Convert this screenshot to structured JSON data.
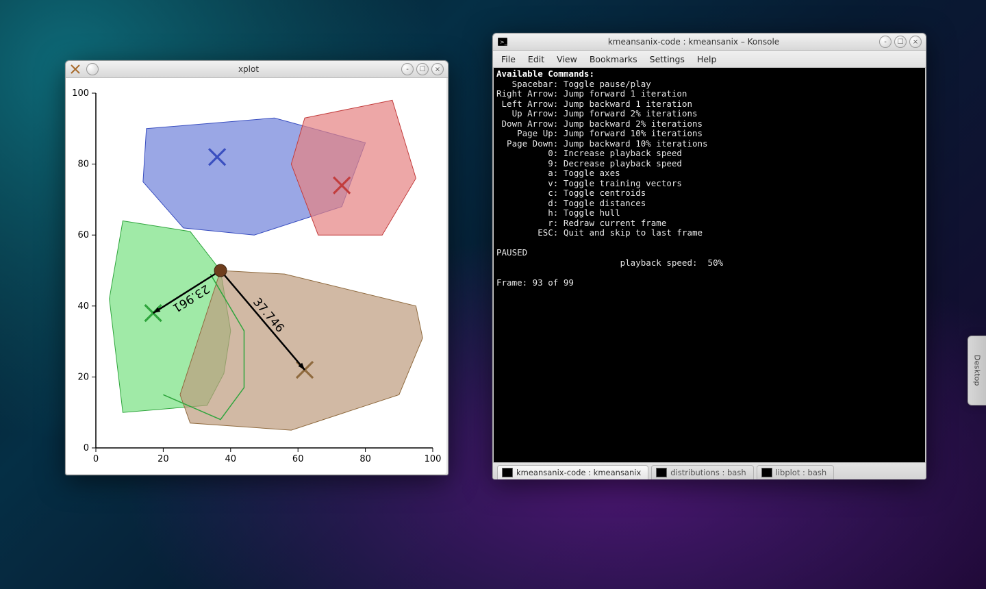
{
  "xplot": {
    "title": "xplot",
    "axis": {
      "xmin": 0,
      "xmax": 100,
      "ymin": 0,
      "ymax": 100,
      "xticks": [
        0,
        20,
        40,
        60,
        80,
        100
      ],
      "yticks": [
        0,
        20,
        40,
        60,
        80,
        100
      ]
    }
  },
  "konsole": {
    "title": "kmeansanix-code : kmeansanix – Konsole",
    "menu": {
      "file": "File",
      "edit": "Edit",
      "view": "View",
      "bookmarks": "Bookmarks",
      "settings": "Settings",
      "help": "Help"
    },
    "header": "Available Commands:",
    "commands": [
      {
        "k": "Spacebar",
        "d": "Toggle pause/play"
      },
      {
        "k": "Right Arrow",
        "d": "Jump forward 1 iteration"
      },
      {
        "k": "Left Arrow",
        "d": "Jump backward 1 iteration"
      },
      {
        "k": "Up Arrow",
        "d": "Jump forward 2% iterations"
      },
      {
        "k": "Down Arrow",
        "d": "Jump backward 2% iterations"
      },
      {
        "k": "Page Up",
        "d": "Jump forward 10% iterations"
      },
      {
        "k": "Page Down",
        "d": "Jump backward 10% iterations"
      },
      {
        "k": "0",
        "d": "Increase playback speed"
      },
      {
        "k": "9",
        "d": "Decrease playback speed"
      },
      {
        "k": "a",
        "d": "Toggle axes"
      },
      {
        "k": "v",
        "d": "Toggle training vectors"
      },
      {
        "k": "c",
        "d": "Toggle centroids"
      },
      {
        "k": "d",
        "d": "Toggle distances"
      },
      {
        "k": "h",
        "d": "Toggle hull"
      },
      {
        "k": "r",
        "d": "Redraw current frame"
      },
      {
        "k": "ESC",
        "d": "Quit and skip to last frame"
      }
    ],
    "paused": "PAUSED",
    "speed_label": "playback speed:",
    "speed_value": "50%",
    "frame": "Frame: 93 of 99",
    "tabs": [
      {
        "label": "kmeansanix-code : kmeansanix",
        "active": true
      },
      {
        "label": "distributions : bash",
        "active": false
      },
      {
        "label": "libplot : bash",
        "active": false
      }
    ]
  },
  "desk_button": "Desktop",
  "chart_data": {
    "type": "scatter",
    "title": "",
    "xlabel": "",
    "ylabel": "",
    "xlim": [
      0,
      100
    ],
    "ylim": [
      0,
      100
    ],
    "clusters": [
      {
        "name": "blue",
        "color": "#5a6fd4",
        "centroid": [
          36,
          82
        ],
        "hull": [
          [
            15,
            90
          ],
          [
            53,
            93
          ],
          [
            80,
            86
          ],
          [
            73,
            68
          ],
          [
            47,
            60
          ],
          [
            26,
            62
          ],
          [
            14,
            75
          ]
        ]
      },
      {
        "name": "red",
        "color": "#e07a7a",
        "centroid": [
          73,
          74
        ],
        "hull": [
          [
            62,
            93
          ],
          [
            88,
            98
          ],
          [
            95,
            76
          ],
          [
            85,
            60
          ],
          [
            66,
            60
          ],
          [
            58,
            80
          ]
        ]
      },
      {
        "name": "green",
        "color": "#6fd97a",
        "centroid": [
          17,
          38
        ],
        "hull": [
          [
            8,
            64
          ],
          [
            28,
            61
          ],
          [
            37,
            50
          ],
          [
            40,
            33
          ],
          [
            38,
            21
          ],
          [
            33,
            12
          ],
          [
            8,
            10
          ],
          [
            4,
            42
          ]
        ]
      },
      {
        "name": "tan",
        "color": "#b98e6f",
        "centroid": [
          62,
          22
        ],
        "hull": [
          [
            37,
            50
          ],
          [
            56,
            49
          ],
          [
            95,
            40
          ],
          [
            97,
            31
          ],
          [
            90,
            15
          ],
          [
            58,
            5
          ],
          [
            28,
            7
          ],
          [
            25,
            15
          ]
        ]
      }
    ],
    "green_outline_hull": [
      [
        34,
        49
      ],
      [
        44,
        33
      ],
      [
        44,
        17
      ],
      [
        37,
        8
      ],
      [
        20,
        15
      ]
    ],
    "query_point": [
      37,
      50
    ],
    "distances": [
      {
        "to": "green",
        "value": 23.961
      },
      {
        "to": "tan",
        "value": 37.746
      }
    ]
  }
}
